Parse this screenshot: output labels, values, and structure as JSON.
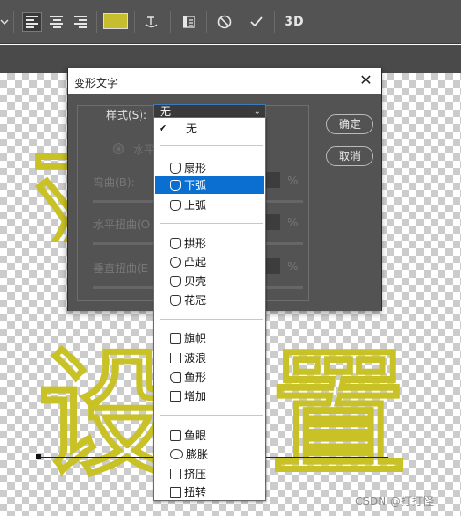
{
  "toolbar": {
    "color_swatch": "#c7be2f",
    "icons": [
      "align-left-icon",
      "align-center-icon",
      "align-right-icon",
      "warp-text-icon",
      "panels-icon",
      "cancel-icon",
      "commit-icon"
    ],
    "threed_label": "3D"
  },
  "canvas": {
    "chars": [
      "双",
      "设",
      "置"
    ],
    "text_color": "#c9c226"
  },
  "watermark": "CSDN @打打怪",
  "dialog": {
    "title": "变形文字",
    "close_glyph": "✕",
    "style_label": "样式(S):",
    "style_value": "无",
    "orientation_horizontal": "水平",
    "bend_label": "弯曲(B):",
    "h_distortion_label": "水平扭曲(O",
    "v_distortion_label": "垂直扭曲(E",
    "percent": "%",
    "ok_label": "确定",
    "cancel_label": "取消"
  },
  "dropdown": {
    "checked_item": "无",
    "groups": [
      [
        "扇形",
        "下弧",
        "上弧"
      ],
      [
        "拱形",
        "凸起",
        "贝壳",
        "花冠"
      ],
      [
        "旗帜",
        "波浪",
        "鱼形",
        "增加"
      ],
      [
        "鱼眼",
        "膨胀",
        "挤压",
        "扭转"
      ]
    ],
    "selected": "下弧"
  }
}
